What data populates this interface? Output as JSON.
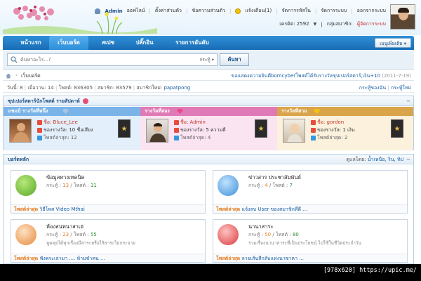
{
  "header": {
    "user_name": "Admin",
    "online_status": "ออฟไลน์",
    "personal_settings": "ตั้งค่าส่วนตัว",
    "private_messages": "ข้อความส่วนตัว",
    "notifications": "แจ้งเตือน(1)",
    "manage_topics": "จัดการรหัสใน",
    "manage_system": "จัดการระบบ",
    "logout": "ออกจากระบบ",
    "credit_label": "เครดิต: 2592",
    "group_label": "กลุ่มสมาชิก:",
    "group_value": "ผู้จัดการระบบ"
  },
  "nav": {
    "items": [
      {
        "label": "หน้าแรก"
      },
      {
        "label": "เว็บบอร์ด"
      },
      {
        "label": "สเปซ"
      },
      {
        "label": "ปลั๊กอิน"
      },
      {
        "label": "รายการอันดับ"
      }
    ],
    "active_index": 1,
    "extra_menu": "เมนูเพิ่มเติม"
  },
  "search": {
    "placeholder": "ค้นหาอะไร...?",
    "type_label": "กระทู้",
    "button_label": "ค้นหา"
  },
  "breadcrumb": {
    "current": "เว็บบอร์ด",
    "notice": "ขอแสดงความยินดีbomcyberโพสต์ได้รับรางวัลซุปเปอร์สตาร์,เงิน+10",
    "notice_date": "(2011-7-19)"
  },
  "stats": {
    "today": "วันนี้: 8",
    "yesterday": "เมื่อวาน: 14",
    "posts": "โพสต์: 836305",
    "members": "สมาชิก: 83579",
    "newest_label": "สมาชิกใหม่:",
    "newest_member": "papatpong",
    "my_posts": "กระทู้ของฉัน",
    "new_posts": "กระทู้ใหม่"
  },
  "ranking": {
    "title": "ซุปเปอร์สตาร์นักโพสต์ รายสัปดาห์",
    "columns": [
      {
        "title": "แชมป์ รางวัลที่หนึ่ง",
        "name": "ชื่อ: Bluce_Lee",
        "reward": "ของรางวัล: 10 ชื่อเสียง",
        "latest": "โพสต์ล่าสุด: 12",
        "color": "#7ab3e8",
        "bg": "#e3effa"
      },
      {
        "title": "รางวัลที่สอง",
        "name": "ชื่อ: Admin",
        "reward": "ของรางวัล: 5 ความดี",
        "latest": "โพสต์ล่าสุด: 4",
        "color": "#e07ab6",
        "bg": "#fbe4f1"
      },
      {
        "title": "รางวัลที่สาม",
        "name": "ชื่อ: gordon",
        "reward": "ของรางวัล: 1 เงิน",
        "latest": "โพสต์ล่าสุด: 2",
        "color": "#d9a44a",
        "bg": "#fbf1dc"
      }
    ]
  },
  "boards": {
    "title": "บอร์ดหลัก",
    "moderators_label": "ดูแลโดย:",
    "moderators": "น้ำเหนือ, ริน, ทิป",
    "forums": [
      {
        "title": "ข้อมูลทางเทคนิค",
        "threads_label": "กระทู้ :",
        "threads": "13",
        "posts_label": "โพสต์ :",
        "posts": "31",
        "desc": "",
        "last_label": "โพสต์ล่าสุด",
        "last_title": "วิธีโพส Video Mthai",
        "icon_color": "#6cbf3a"
      },
      {
        "title": "ข่าวสาร ประชาสัมพันธ์",
        "threads_label": "กระทู้ :",
        "threads": "4",
        "posts_label": "โพสต์ :",
        "posts": "7",
        "desc": "",
        "last_label": "โพสต์ล่าสุด",
        "last_title": "แจ้งลบ User ของสมาชิกที่ดี ...",
        "icon_color": "#4aa3e8"
      },
      {
        "title": "ห้องสนทนาสาเฮ",
        "threads_label": "กระทู้ :",
        "threads": "23",
        "posts_label": "โพสต์ :",
        "posts": "55",
        "desc": "พูดคุยได้ทุกเรื่องมีสาระหรือไร้สาระไม่กระจาย",
        "last_label": "โพสต์ล่าสุด",
        "last_title": "ฟังพระเล่ามา .... ห้ามขำคน ...",
        "icon_color": "#f0a860"
      },
      {
        "title": "นานาสาระ",
        "threads_label": "กระทู้ :",
        "threads": "50",
        "posts_label": "โพสต์ :",
        "posts": "80",
        "desc": "รวมเรื่องนานาสาระที่เป็นประโยชน์ ไปใช้ในชีวิตประจำวัน",
        "last_label": "โพสต์ล่าสุด",
        "last_title": "ลายเส้นสีกลับแห่งนาซาคา ...",
        "icon_color": "#e54c4c"
      }
    ]
  },
  "watermark": "[978x620] https://upic.me/"
}
